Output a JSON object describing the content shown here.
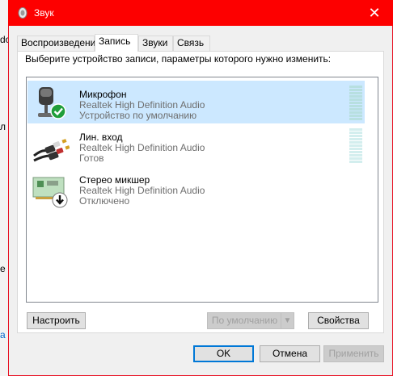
{
  "window": {
    "title": "Звук",
    "close_glyph": "✕"
  },
  "tabs": [
    {
      "label": "Воспроизведение"
    },
    {
      "label": "Запись"
    },
    {
      "label": "Звуки"
    },
    {
      "label": "Связь"
    }
  ],
  "instruction": "Выберите устройство записи, параметры которого нужно изменить:",
  "devices": [
    {
      "name": "Микрофон",
      "driver": "Realtek High Definition Audio",
      "status": "Устройство по умолчанию",
      "icon": "microphone-icon",
      "selected": true
    },
    {
      "name": "Лин. вход",
      "driver": "Realtek High Definition Audio",
      "status": "Готов",
      "icon": "line-in-icon",
      "selected": false
    },
    {
      "name": "Стерео микшер",
      "driver": "Realtek High Definition Audio",
      "status": "Отключено",
      "icon": "stereo-mixer-icon",
      "selected": false
    }
  ],
  "buttons": {
    "configure": "Настроить",
    "default": "По умолчанию",
    "properties": "Свойства",
    "ok": "OK",
    "cancel": "Отмена",
    "apply": "Применить"
  },
  "background_fragments": [
    "do",
    "л",
    "е",
    "а"
  ],
  "colors": {
    "titlebar": "#fd0000",
    "selection": "#cce8ff",
    "accent": "#0078d7"
  }
}
